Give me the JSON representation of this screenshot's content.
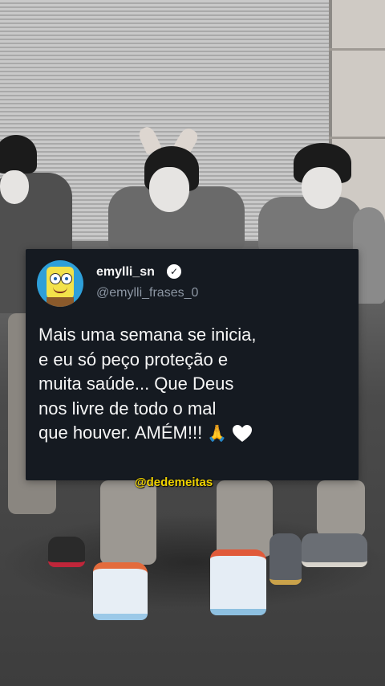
{
  "tweet": {
    "username": "emylli_sn",
    "handle": "@emylli_frases_0",
    "text": "Mais uma semana se inicia,\ne eu só peço proteção e\nmuita saúde... Que Deus\nnos livre de todo o mal\nque houver. AMÉM!!! ",
    "pray_emoji": "🙏",
    "heart_emoji": "white-heart-icon",
    "verified_icon": "verified-check-icon",
    "avatar_icon": "spongebob-avatar",
    "card_color": "#151a21",
    "text_color": "#f6f6f6",
    "handle_color": "#8c96a3"
  },
  "overlay": {
    "handle": "@dedemeitas",
    "color": "#f0d300"
  },
  "background": {
    "description_icon": "video-background-dancers"
  }
}
